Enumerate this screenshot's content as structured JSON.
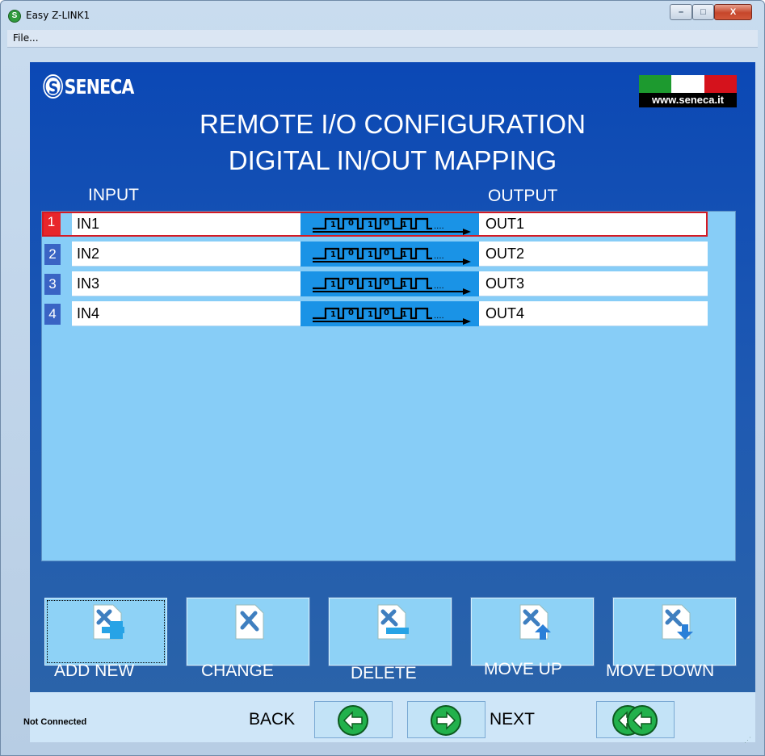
{
  "window": {
    "title": "Easy Z-LINK1",
    "minimize_symbol": "–",
    "maximize_symbol": "□",
    "close_symbol": "X",
    "app_icon": "seneca-icon"
  },
  "menu": {
    "file": "File..."
  },
  "header": {
    "logo": "SENECA",
    "logo_mark": "S",
    "website": "www.seneca.it",
    "title_line1": "REMOTE I/O CONFIGURATION",
    "title_line2": "DIGITAL IN/OUT MAPPING"
  },
  "columns": {
    "input": "INPUT",
    "output": "OUTPUT"
  },
  "rows": [
    {
      "num": "1",
      "input": "IN1",
      "output": "OUT1",
      "selected": true
    },
    {
      "num": "2",
      "input": "IN2",
      "output": "OUT2",
      "selected": false
    },
    {
      "num": "3",
      "input": "IN3",
      "output": "OUT3",
      "selected": false
    },
    {
      "num": "4",
      "input": "IN4",
      "output": "OUT4",
      "selected": false
    }
  ],
  "toolbar": {
    "add_new": "ADD NEW",
    "change": "CHANGE",
    "delete": "DELETE",
    "move_up": "MOVE UP",
    "move_down": "MOVE DOWN"
  },
  "status": {
    "connection": "Not Connected",
    "back": "BACK",
    "next": "NEXT"
  },
  "colors": {
    "panel_blue": "#0b48b5",
    "grid_bg": "#87cdf7",
    "signal_blue": "#1a93e6",
    "selected_red": "#e8262b",
    "nav_green": "#22b14c"
  }
}
